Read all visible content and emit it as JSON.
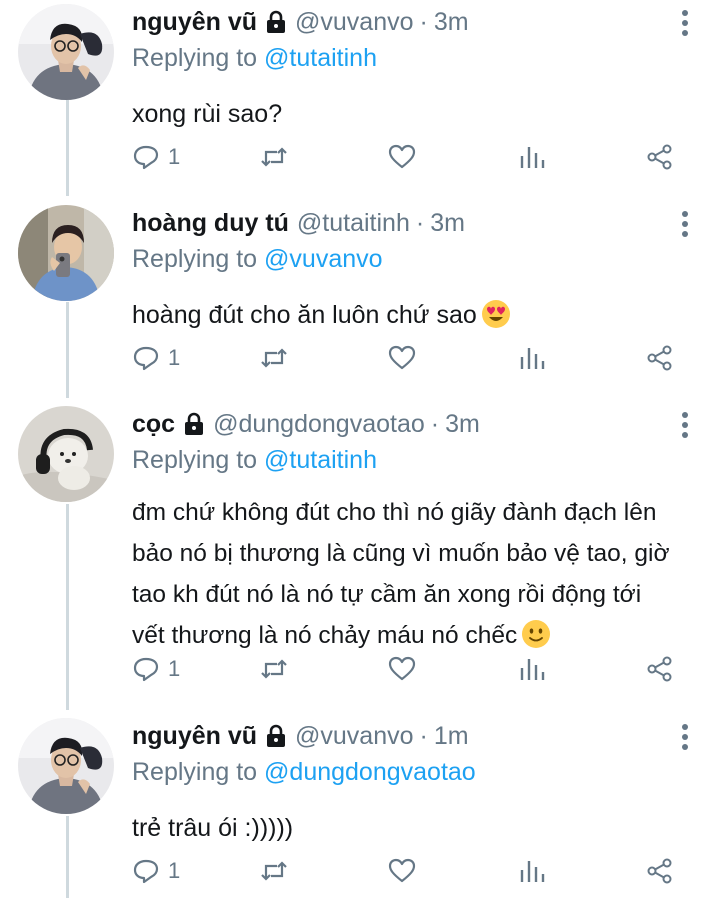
{
  "tweets": [
    {
      "name": "nguyên vũ",
      "locked": true,
      "handle": "@vuvanvo",
      "time": "3m",
      "replying_label": "Replying to",
      "replying_to": "@tutaitinh",
      "text": "xong rùi sao?",
      "reply_count": "1",
      "avatar": "avatar-man-glasses"
    },
    {
      "name": "hoàng duy tú",
      "locked": false,
      "handle": "@tutaitinh",
      "time": "3m",
      "replying_label": "Replying to",
      "replying_to": "@vuvanvo",
      "text": "hoàng đút cho ăn luôn chứ sao",
      "emoji": "heart-eyes-emoji",
      "reply_count": "1",
      "avatar": "avatar-mirror-selfie"
    },
    {
      "name": "cọc",
      "locked": true,
      "handle": "@dungdongvaotao",
      "time": "3m",
      "replying_label": "Replying to",
      "replying_to": "@tutaitinh",
      "text": "đm chứ không đút cho thì nó giãy đành đạch lên bảo nó bị thương là cũng vì muốn bảo vệ tao, giờ tao kh đút nó là nó tự cầm ăn xong rồi động tới vết thương là nó chảy máu nó chếc",
      "text_lines": [
        "đm chứ không đút cho thì nó giãy đành đạch lên",
        "bảo nó bị thương là cũng vì muốn bảo vệ tao, giờ",
        "tao kh đút nó là nó tự cầm ăn xong rồi động tới",
        "vết thương là nó chảy máu nó chếc"
      ],
      "emoji": "slight-smile-emoji",
      "reply_count": "1",
      "avatar": "avatar-plush-bear"
    },
    {
      "name": "nguyên vũ",
      "locked": true,
      "handle": "@vuvanvo",
      "time": "1m",
      "replying_label": "Replying to",
      "replying_to": "@dungdongvaotao",
      "text": "trẻ trâu ói :)))))",
      "reply_count": "1",
      "avatar": "avatar-man-glasses"
    }
  ],
  "separator": "·",
  "colors": {
    "link": "#1da1f2",
    "muted": "#657786",
    "thread_line": "#cfd9de"
  }
}
